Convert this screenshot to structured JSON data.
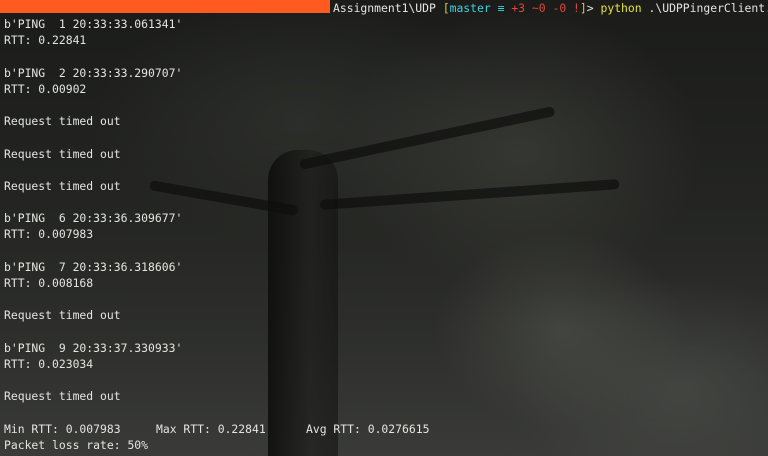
{
  "prompt": {
    "path_suffix": "Assignment1\\UDP ",
    "git_open": "[",
    "git_branch": "master",
    "git_eq": " ≡ ",
    "git_changes": "+3 ~0 -0 !",
    "git_close": "]",
    "prompt_char": "> ",
    "command": "python",
    "command_args": " .\\UDPPingerClient.py"
  },
  "output_lines": [
    "b'PING  1 20:33:33.061341'",
    "RTT: 0.22841",
    "",
    "b'PING  2 20:33:33.290707'",
    "RTT: 0.00902",
    "",
    "Request timed out",
    "",
    "Request timed out",
    "",
    "Request timed out",
    "",
    "b'PING  6 20:33:36.309677'",
    "RTT: 0.007983",
    "",
    "b'PING  7 20:33:36.318606'",
    "RTT: 0.008168",
    "",
    "Request timed out",
    "",
    "b'PING  9 20:33:37.330933'",
    "RTT: 0.023034",
    "",
    "Request timed out",
    ""
  ],
  "summary": {
    "min_rtt": "Min RTT: 0.007983",
    "max_rtt": "Max RTT: 0.22841",
    "avg_rtt": "Avg RTT: 0.0276615",
    "packet_loss": "Packet loss rate: 50%"
  }
}
